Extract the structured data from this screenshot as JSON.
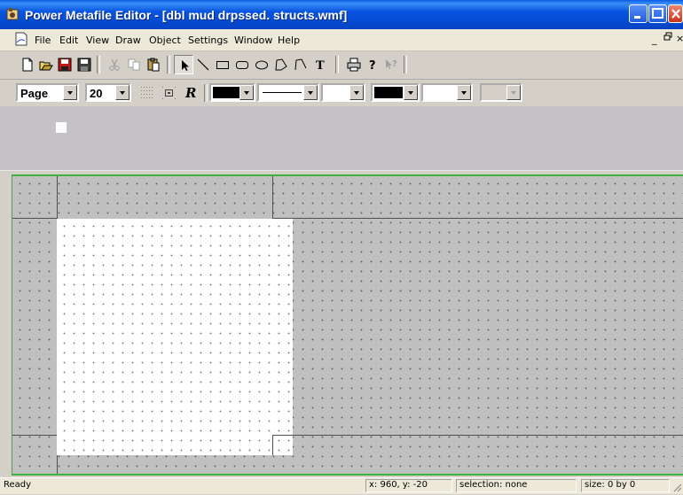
{
  "window": {
    "title": "Power Metafile Editor - [dbl mud drpssed. structs.wmf]"
  },
  "menu": {
    "items": [
      "File",
      "Edit",
      "View",
      "Draw",
      "Object",
      "Settings",
      "Window",
      "Help"
    ]
  },
  "toolbar": {
    "icons": [
      "new-icon",
      "open-icon",
      "save-icon",
      "save-as-icon",
      "cut-icon",
      "copy-icon",
      "paste-icon",
      "select-arrow-icon",
      "line-icon",
      "rectangle-icon",
      "rounded-rectangle-icon",
      "ellipse-icon",
      "polygon-icon",
      "polyline-icon",
      "text-icon",
      "print-icon",
      "help-icon",
      "context-help-icon"
    ]
  },
  "format_bar": {
    "units": "Page",
    "grid_size": "20",
    "fill_color": "#000000",
    "pen_color": "#000000"
  },
  "status": {
    "message": "Ready",
    "coords": "x: 960, y: -20",
    "selection": "selection: none",
    "size": "size: 0 by 0"
  },
  "colors": {
    "title_bar": "#0854e0",
    "canvas_border": "#3cb33c",
    "canvas_bg": "#c0c0c0",
    "page_bg": "#ffffff"
  }
}
